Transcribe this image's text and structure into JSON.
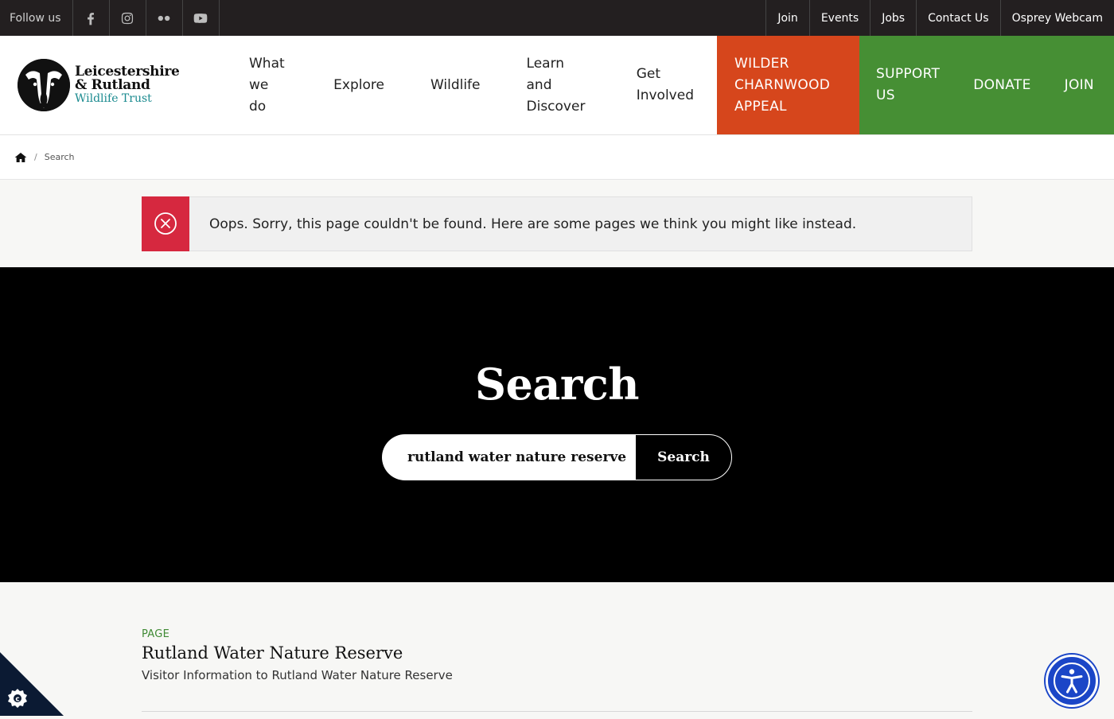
{
  "topbar": {
    "follow_label": "Follow us",
    "social": [
      "facebook-icon",
      "instagram-icon",
      "flickr-icon",
      "youtube-icon"
    ],
    "links": [
      "Join",
      "Events",
      "Jobs",
      "Contact Us",
      "Osprey Webcam"
    ]
  },
  "logo": {
    "line1": "Leicestershire",
    "line2": "& Rutland",
    "line3": "Wildlife Trust"
  },
  "nav": {
    "items": [
      {
        "label_a": "What",
        "label_b": "we do"
      },
      {
        "label_a": "Explore"
      },
      {
        "label_a": "Wildlife"
      },
      {
        "label_a": "Learn and",
        "label_b": "Discover"
      },
      {
        "label_a": "Get",
        "label_b": "Involved"
      }
    ],
    "appeal": {
      "l1": "WILDER",
      "l2": "CHARNWOOD",
      "l3": "APPEAL"
    },
    "support": {
      "l1": "SUPPORT",
      "l2": "US"
    },
    "donate": "DONATE",
    "join": "JOIN"
  },
  "breadcrumb": {
    "current": "Search"
  },
  "alert": {
    "message": "Oops. Sorry, this page couldn't be found. Here are some pages we think you might like instead."
  },
  "search": {
    "title": "Search",
    "query": "rutland water nature reserve",
    "button_label": "Search"
  },
  "results": [
    {
      "type": "PAGE",
      "title": "Rutland Water Nature Reserve",
      "description": "Visitor Information to Rutland Water Nature Reserve"
    }
  ],
  "colors": {
    "topbar": "#231f20",
    "appeal": "#d6461c",
    "support": "#468f34",
    "alert": "#d6283f",
    "accessibility": "#1b46c7",
    "teal": "#1a8a8f"
  }
}
